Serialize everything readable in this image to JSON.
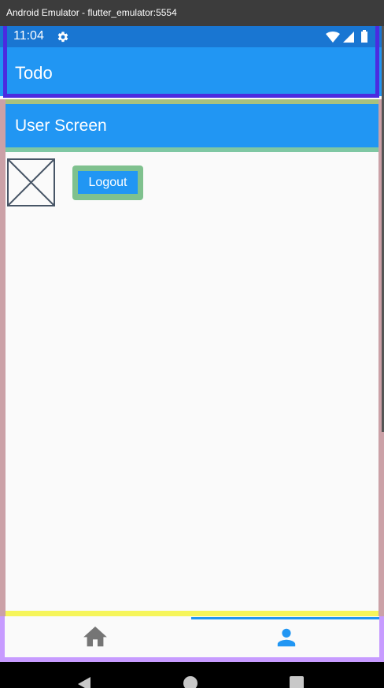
{
  "window": {
    "title": "Android Emulator - flutter_emulator:5554"
  },
  "status_bar": {
    "time": "11:04",
    "icons": [
      "gear-icon",
      "wifi-icon",
      "signal-icon",
      "battery-icon"
    ]
  },
  "app_bar": {
    "title": "Todo"
  },
  "user_screen": {
    "title": "User Screen",
    "image_placeholder": "image-placeholder-icon",
    "logout_label": "Logout"
  },
  "bottom_nav": {
    "items": [
      {
        "icon": "home-icon",
        "selected": false
      },
      {
        "icon": "person-icon",
        "selected": true
      }
    ]
  },
  "system_nav": {
    "icons": [
      "back-icon",
      "home-circle-icon",
      "recents-icon"
    ]
  },
  "colors": {
    "primary": "#2196f3",
    "status_bar": "#1976d2",
    "background": "#fafafa",
    "nav_unselected": "#757575",
    "nav_selected": "#2196f3"
  }
}
